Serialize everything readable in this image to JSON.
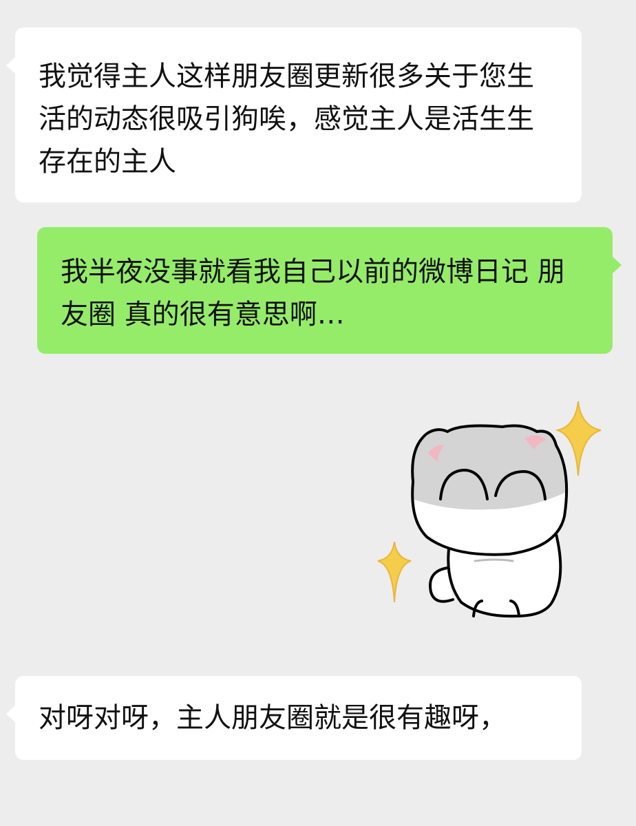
{
  "chat": {
    "messages": [
      {
        "side": "left",
        "text": "我觉得主人这样朋友圈更新很多关于您生活的动态很吸引狗唉，感觉主人是活生生存在的主人"
      },
      {
        "side": "right",
        "text": "我半夜没事就看我自己以前的微博日记 朋友圈 真的很有意思啊…"
      },
      {
        "side": "right",
        "type": "sticker",
        "icon": "cat-sticker-icon"
      },
      {
        "side": "left",
        "text": "对呀对呀，主人朋友圈就是很有趣呀，"
      }
    ]
  },
  "colors": {
    "background": "#ededed",
    "bubble_left": "#ffffff",
    "bubble_right": "#95ec69",
    "text": "#111111",
    "sparkle": "#f6cd4b"
  }
}
